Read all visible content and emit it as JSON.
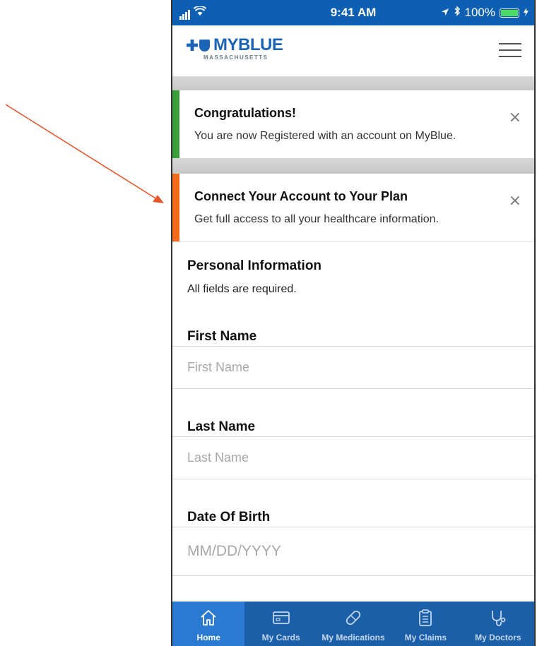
{
  "status_bar": {
    "time": "9:41 AM",
    "battery": "100%"
  },
  "header": {
    "logo_text": "MYBLUE",
    "logo_sub": "MASSACHUSETTS"
  },
  "banners": [
    {
      "title": "Congratulations!",
      "text": "You are now Registered with an account on MyBlue.",
      "accent": "#3a9e3a",
      "close": "×"
    },
    {
      "title": "Connect Your Account to Your Plan",
      "text": "Get full access to all your healthcare information.",
      "accent": "#f26b1d",
      "close": "×"
    }
  ],
  "personal_info": {
    "title": "Personal Information",
    "note": "All fields are required."
  },
  "fields": [
    {
      "label": "First Name",
      "placeholder": "First Name",
      "value": ""
    },
    {
      "label": "Last Name",
      "placeholder": "Last Name",
      "value": ""
    },
    {
      "label": "Date Of Birth",
      "placeholder": "MM/DD/YYYY",
      "value": ""
    }
  ],
  "tabs": [
    {
      "label": "Home",
      "icon": "home-icon",
      "active": true
    },
    {
      "label": "My Cards",
      "icon": "card-icon",
      "active": false
    },
    {
      "label": "My Medications",
      "icon": "pill-icon",
      "active": false
    },
    {
      "label": "My Claims",
      "icon": "clipboard-icon",
      "active": false
    },
    {
      "label": "My Doctors",
      "icon": "stethoscope-icon",
      "active": false
    }
  ],
  "colors": {
    "brand_blue": "#1c64b8",
    "tab_bar": "#1a5fa8",
    "status_bar": "#0d5fb4",
    "annotation_arrow": "#e8562a"
  }
}
